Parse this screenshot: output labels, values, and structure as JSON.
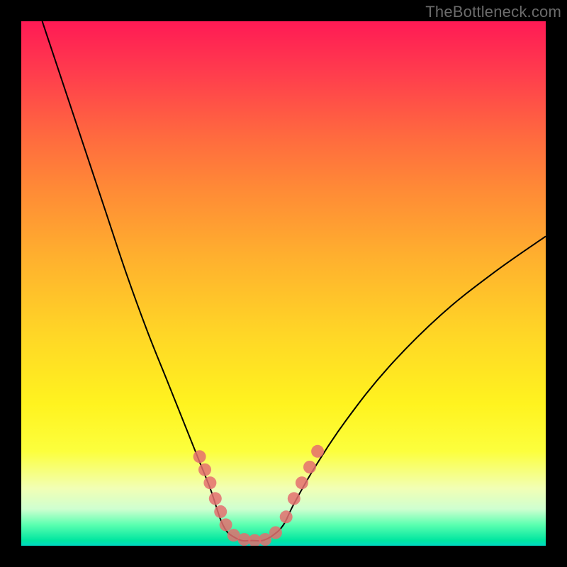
{
  "watermark": "TheBottleneck.com",
  "chart_data": {
    "type": "line",
    "title": "",
    "xlabel": "",
    "ylabel": "",
    "xlim": [
      0,
      100
    ],
    "ylim": [
      0,
      100
    ],
    "grid": false,
    "legend": false,
    "background_gradient": [
      "#ff1a55",
      "#ff8a36",
      "#fff31f",
      "#00e6a0"
    ],
    "series": [
      {
        "name": "bottleneck-curve",
        "color": "#000000",
        "x": [
          4,
          8,
          12,
          16,
          20,
          24,
          28,
          32,
          34,
          36,
          37,
          38,
          39,
          40,
          42,
          44,
          46,
          48,
          50,
          52,
          56,
          62,
          70,
          80,
          90,
          100
        ],
        "y": [
          100,
          88,
          76,
          64,
          52,
          41,
          31,
          21,
          16,
          11,
          8,
          5,
          3,
          2,
          1,
          1,
          1,
          2,
          4,
          8,
          15,
          24,
          34,
          44,
          52,
          59
        ]
      }
    ],
    "markers": {
      "name": "highlight-dots",
      "color": "#e46f6f",
      "points": [
        {
          "x": 34.0,
          "y": 17.0
        },
        {
          "x": 35.0,
          "y": 14.5
        },
        {
          "x": 36.0,
          "y": 12.0
        },
        {
          "x": 37.0,
          "y": 9.0
        },
        {
          "x": 38.0,
          "y": 6.5
        },
        {
          "x": 39.0,
          "y": 4.0
        },
        {
          "x": 40.5,
          "y": 2.0
        },
        {
          "x": 42.5,
          "y": 1.2
        },
        {
          "x": 44.5,
          "y": 1.0
        },
        {
          "x": 46.5,
          "y": 1.2
        },
        {
          "x": 48.5,
          "y": 2.5
        },
        {
          "x": 50.5,
          "y": 5.5
        },
        {
          "x": 52.0,
          "y": 9.0
        },
        {
          "x": 53.5,
          "y": 12.0
        },
        {
          "x": 55.0,
          "y": 15.0
        },
        {
          "x": 56.5,
          "y": 18.0
        }
      ]
    }
  }
}
